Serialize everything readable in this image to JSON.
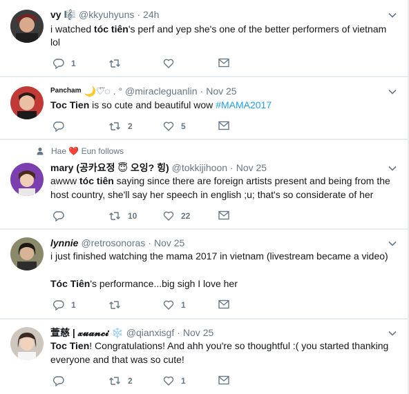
{
  "tweets": [
    {
      "name": "vy",
      "name_emoji": "🎼",
      "handle": "@kkyuhyuns",
      "time": "24h",
      "pre": "i watched ",
      "bold": "tóc tiên",
      "post": "'s perf and yep she's one of the better performers of vietnam",
      "line2": "lol",
      "replies": "1",
      "retweets": "",
      "likes": ""
    },
    {
      "name": "Pancham",
      "name_emoji": "🌙♡⃛◌ . °",
      "handle": "@miracleguanlin",
      "time": "Nov 25",
      "bold": "Toc Tien",
      "post": " is so cute and beautiful wow ",
      "hashtag": "#MAMA2017",
      "replies": "",
      "retweets": "2",
      "likes": "5"
    },
    {
      "context": "Hae ❤️ Eun follows",
      "name": "mary (공카요정 😇 오잉? 힝)",
      "handle": "@tokkijihoon",
      "time": "Nov 25",
      "pre": "awww ",
      "bold": "tóc tiên",
      "post": " saying since there are foreign artists present and being from the",
      "line2": "host country, she'll say her speech in english ;u; that's so considerate of her",
      "replies": "",
      "retweets": "10",
      "likes": "22"
    },
    {
      "name": "lynnie",
      "handle": "@retrosonoras",
      "time": "Nov 25",
      "line1": "i just finished watching the mama 2017 in vietnam (livestream became a video)",
      "bold": "Tóc Tiên",
      "post": "'s performance...big sigh I love her",
      "replies": "1",
      "retweets": "",
      "likes": "1"
    },
    {
      "name": "萱慈 | 𝔁𝓾𝓪𝓷𝓬𝓲",
      "name_emoji": "❄️",
      "handle": "@qianxisgf",
      "time": "Nov 25",
      "bold": "Toc Tien",
      "post": "! Congratulations! And ahh you're so thoughtful :( you started thanking",
      "line2": "everyone and that was so cute!",
      "replies": "",
      "retweets": "2",
      "likes": "1"
    }
  ],
  "colors": {
    "text": "#14171a",
    "muted": "#657786",
    "link": "#1da1f2",
    "divider": "#e6ecf0"
  },
  "icons": [
    "reply-icon",
    "retweet-icon",
    "like-icon",
    "dm-icon",
    "caret-down-icon",
    "person-icon",
    "heart-emoji"
  ]
}
